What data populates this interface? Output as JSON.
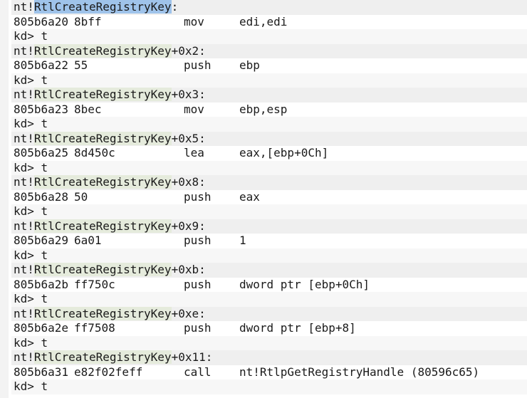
{
  "entries": [
    {
      "prefix": "nt!",
      "symbol": "RtlCreateRegistryKey",
      "suffix": ":",
      "selected": true,
      "addr": "805b6a20",
      "bytes": "8bff",
      "mnemonic": "mov",
      "operands": "edi,edi",
      "prompt": "kd> t"
    },
    {
      "prefix": "nt!",
      "symbol": "RtlCreateRegistryKey",
      "suffix": "+0x2:",
      "selected": false,
      "addr": "805b6a22",
      "bytes": "55",
      "mnemonic": "push",
      "operands": "ebp",
      "prompt": "kd> t"
    },
    {
      "prefix": "nt!",
      "symbol": "RtlCreateRegistryKey",
      "suffix": "+0x3:",
      "selected": false,
      "addr": "805b6a23",
      "bytes": "8bec",
      "mnemonic": "mov",
      "operands": "ebp,esp",
      "prompt": "kd> t"
    },
    {
      "prefix": "nt!",
      "symbol": "RtlCreateRegistryKey",
      "suffix": "+0x5:",
      "selected": false,
      "addr": "805b6a25",
      "bytes": "8d450c",
      "mnemonic": "lea",
      "operands": "eax,[ebp+0Ch]",
      "prompt": "kd> t"
    },
    {
      "prefix": "nt!",
      "symbol": "RtlCreateRegistryKey",
      "suffix": "+0x8:",
      "selected": false,
      "addr": "805b6a28",
      "bytes": "50",
      "mnemonic": "push",
      "operands": "eax",
      "prompt": "kd> t"
    },
    {
      "prefix": "nt!",
      "symbol": "RtlCreateRegistryKey",
      "suffix": "+0x9:",
      "selected": false,
      "addr": "805b6a29",
      "bytes": "6a01",
      "mnemonic": "push",
      "operands": "1",
      "prompt": "kd> t"
    },
    {
      "prefix": "nt!",
      "symbol": "RtlCreateRegistryKey",
      "suffix": "+0xb:",
      "selected": false,
      "addr": "805b6a2b",
      "bytes": "ff750c",
      "mnemonic": "push",
      "operands": "dword ptr [ebp+0Ch]",
      "prompt": "kd> t"
    },
    {
      "prefix": "nt!",
      "symbol": "RtlCreateRegistryKey",
      "suffix": "+0xe:",
      "selected": false,
      "addr": "805b6a2e",
      "bytes": "ff7508",
      "mnemonic": "push",
      "operands": "dword ptr [ebp+8]",
      "prompt": "kd> t"
    },
    {
      "prefix": "nt!",
      "symbol": "RtlCreateRegistryKey",
      "suffix": "+0x11:",
      "selected": false,
      "addr": "805b6a31",
      "bytes": "e82f02feff",
      "mnemonic": "call",
      "operands": "nt!RtlpGetRegistryHandle (80596c65)",
      "prompt": "kd> t"
    }
  ],
  "colors": {
    "header_bg": "#efefef",
    "symbol_highlight": "#e5ebdc",
    "selection": "#9fc3ea",
    "text": "#1a1a1a"
  }
}
